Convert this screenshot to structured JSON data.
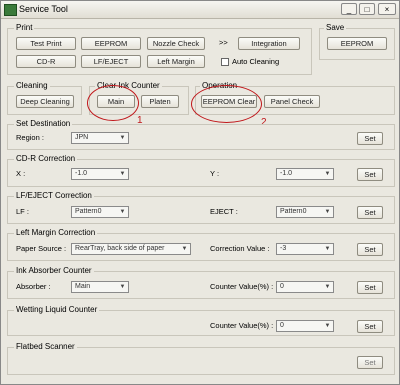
{
  "window": {
    "title": "Service Tool",
    "minimize": "_",
    "maximize": "□",
    "close": "×"
  },
  "print": {
    "label": "Print",
    "test_print": "Test Print",
    "eeprom": "EEPROM",
    "nozzle_check": "Nozzle Check",
    "arrows": ">>",
    "integration": "Integration",
    "cdr": "CD-R",
    "lf_eject": "LF/EJECT",
    "left_margin": "Left Margin",
    "auto_cleaning": "Auto Cleaning"
  },
  "save": {
    "label": "Save",
    "eeprom": "EEPROM"
  },
  "cleaning": {
    "label": "Cleaning",
    "deep_cleaning": "Deep Cleaning"
  },
  "clear_ink_counter": {
    "label": "Clear Ink Counter",
    "main": "Main",
    "platen": "Platen"
  },
  "operation": {
    "label": "Operation",
    "eeprom_clear": "EEPROM Clear",
    "panel_check": "Panel Check"
  },
  "annotations": {
    "one": "1",
    "two": "2",
    "color": "#c0161a"
  },
  "set_destination": {
    "label": "Set Destination",
    "region_label": "Region :",
    "region_value": "JPN",
    "set": "Set"
  },
  "cdr_correction": {
    "label": "CD-R Correction",
    "x_label": "X :",
    "x_value": "-1.0",
    "y_label": "Y :",
    "y_value": "-1.0",
    "set": "Set"
  },
  "lf_eject_correction": {
    "label": "LF/EJECT Correction",
    "lf_label": "LF :",
    "lf_value": "Pattern0",
    "eject_label": "EJECT :",
    "eject_value": "Pattern0",
    "set": "Set"
  },
  "left_margin_correction": {
    "label": "Left Margin Correction",
    "paper_label": "Paper Source :",
    "paper_value": "RearTray, back side of paper",
    "corr_label": "Correction Value :",
    "corr_value": "-3",
    "set": "Set"
  },
  "ink_absorber": {
    "label": "Ink Absorber Counter",
    "absorber_label": "Absorber :",
    "absorber_value": "Main",
    "counter_label": "Counter Value(%) :",
    "counter_value": "0",
    "set": "Set"
  },
  "wetting_liquid": {
    "label": "Wetting Liquid Counter",
    "counter_label": "Counter Value(%) :",
    "counter_value": "0",
    "set": "Set"
  },
  "flatbed": {
    "label": "Flatbed Scanner",
    "set": "Set"
  }
}
